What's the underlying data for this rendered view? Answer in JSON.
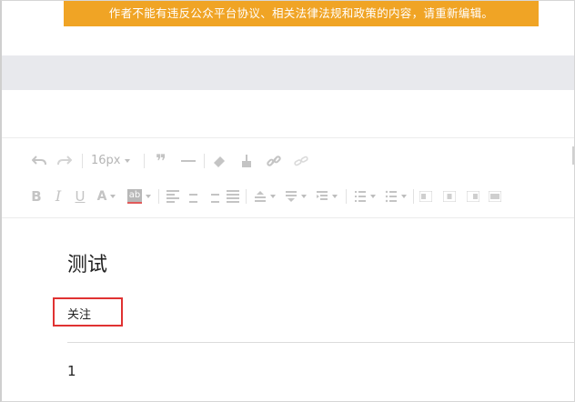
{
  "banner": {
    "message": "作者不能有违反公众平台协议、相关法律法规和政策的内容，请重新编辑。",
    "color": "#f0a425"
  },
  "toolbar": {
    "row1": {
      "undo_icon": "undo-icon",
      "redo_icon": "redo-icon",
      "font_size": "16px",
      "quote_icon": "quote-icon",
      "hr_icon": "horizontal-rule-icon",
      "eraser_icon": "eraser-icon",
      "format_brush_icon": "format-brush-icon",
      "link_icon": "link-icon",
      "unlink_icon": "unlink-icon"
    },
    "row2": {
      "bold_label": "B",
      "italic_label": "I",
      "underline_label": "U",
      "font_color_label": "A",
      "bg_color_label": "ab"
    }
  },
  "editor": {
    "title": "测试",
    "follow_text": "关注",
    "body_text": "1",
    "highlight_color": "#e03232"
  }
}
